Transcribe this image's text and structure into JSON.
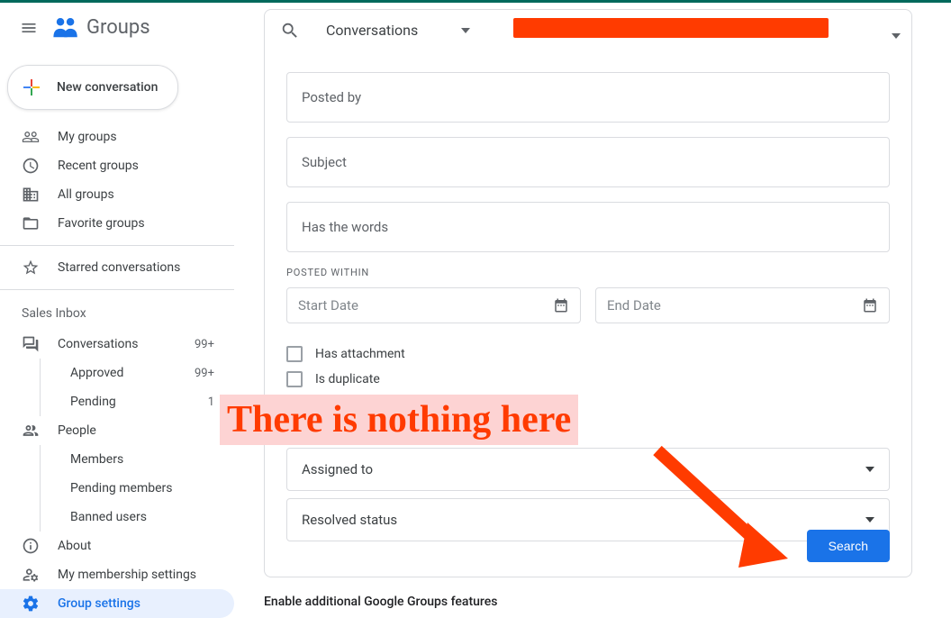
{
  "app": {
    "name": "Groups"
  },
  "header": {
    "search_scope": "Conversations"
  },
  "sidebar": {
    "new_conversation": "New conversation",
    "nav": {
      "my_groups": "My groups",
      "recent_groups": "Recent groups",
      "all_groups": "All groups",
      "favorite_groups": "Favorite groups",
      "starred_conversations": "Starred conversations"
    },
    "section_label": "Sales Inbox",
    "group_nav": {
      "conversations": {
        "label": "Conversations",
        "badge": "99+"
      },
      "approved": {
        "label": "Approved",
        "badge": "99+"
      },
      "pending": {
        "label": "Pending",
        "badge": "1"
      },
      "people": "People",
      "members": "Members",
      "pending_members": "Pending members",
      "banned_users": "Banned users",
      "about": "About",
      "membership_settings": "My membership settings",
      "group_settings": "Group settings"
    }
  },
  "search_form": {
    "posted_by": "Posted by",
    "subject": "Subject",
    "has_words": "Has the words",
    "posted_within_label": "POSTED WITHIN",
    "start_date": "Start Date",
    "end_date": "End Date",
    "has_attachment": "Has attachment",
    "is_duplicate": "Is duplicate",
    "assigned_to": "Assigned to",
    "resolved_status": "Resolved status",
    "search_button": "Search"
  },
  "footer": {
    "enable_features": "Enable additional Google Groups features"
  },
  "annotation": {
    "text": "There is nothing here"
  }
}
